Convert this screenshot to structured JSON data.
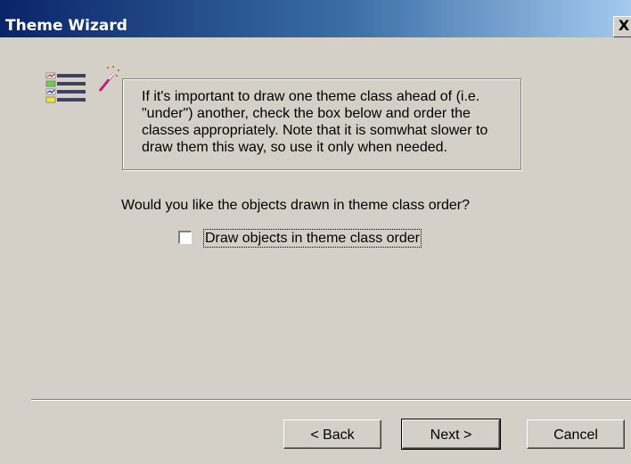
{
  "window": {
    "title": "Theme Wizard",
    "close_label": "X"
  },
  "intro": {
    "lines": [
      "If it's important to draw one theme class ahead of (i.e.",
      "\"under\") another, check the box below and order the",
      "classes appropriately.  Note that it is somwhat slower to",
      "draw them this way, so use it only when needed."
    ]
  },
  "question": "Would you like the objects drawn in theme class order?",
  "checkbox": {
    "label": "Draw objects in theme class order",
    "checked": false
  },
  "buttons": {
    "back": "< Back",
    "next": "Next >",
    "cancel": "Cancel"
  },
  "icons": {
    "wizard": "theme-wizard-icon",
    "close": "close-icon"
  }
}
